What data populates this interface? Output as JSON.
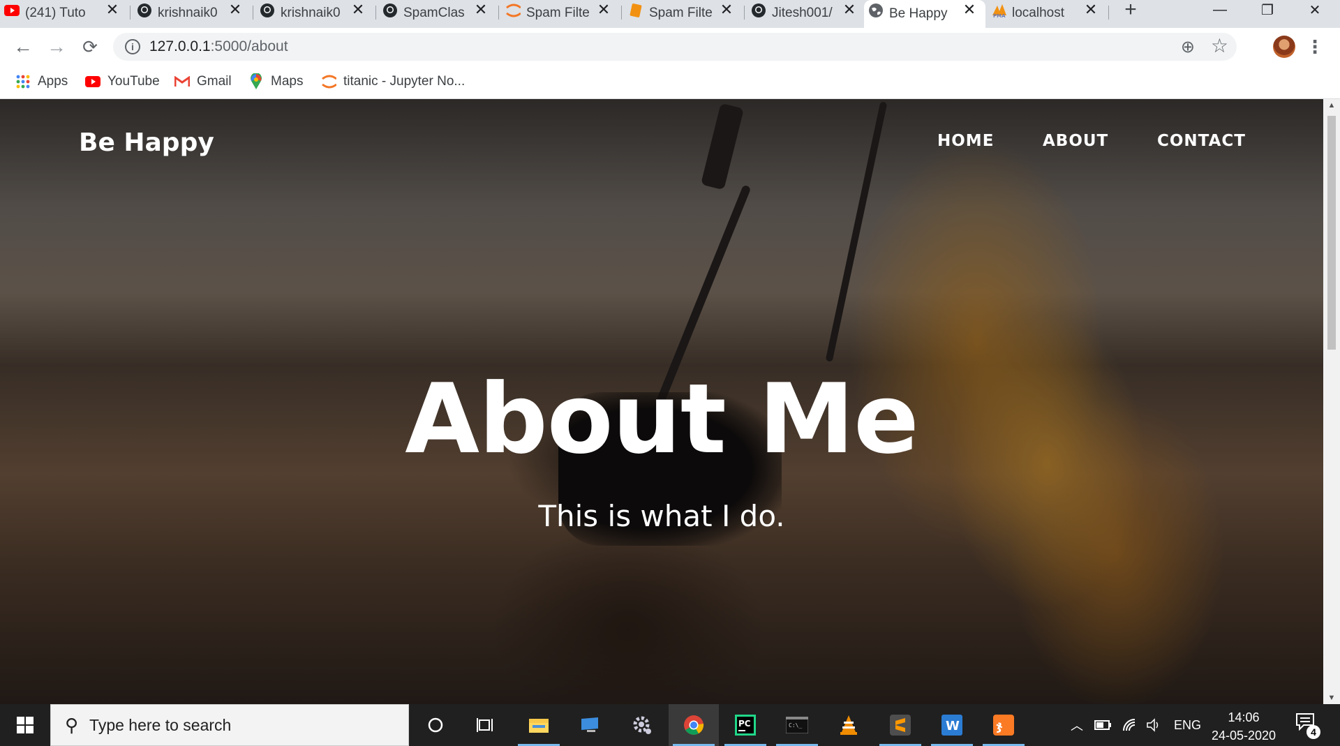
{
  "browser": {
    "tabs": [
      {
        "title": "(241) Tuto",
        "icon": "youtube-icon"
      },
      {
        "title": "krishnaik0",
        "icon": "github-icon"
      },
      {
        "title": "krishnaik0",
        "icon": "github-icon"
      },
      {
        "title": "SpamClas",
        "icon": "github-icon"
      },
      {
        "title": "Spam Filte",
        "icon": "jupyter-icon"
      },
      {
        "title": "Spam Filte",
        "icon": "notebook-icon"
      },
      {
        "title": "Jitesh001/",
        "icon": "github-icon"
      },
      {
        "title": "Be Happy",
        "icon": "globe-icon"
      },
      {
        "title": "localhost",
        "icon": "phpmyadmin-icon"
      }
    ],
    "new_tab_label": "+",
    "url_host": "127.0.0.1",
    "url_path": ":5000/about",
    "bookmarks": [
      {
        "label": "Apps",
        "icon": "apps-grid-icon"
      },
      {
        "label": "YouTube",
        "icon": "youtube-icon"
      },
      {
        "label": "Gmail",
        "icon": "gmail-icon"
      },
      {
        "label": "Maps",
        "icon": "maps-pin-icon"
      },
      {
        "label": "titanic - Jupyter No...",
        "icon": "jupyter-icon"
      }
    ]
  },
  "site": {
    "brand": "Be Happy",
    "nav": {
      "home": "HOME",
      "about": "ABOUT",
      "contact": "CONTACT"
    },
    "heading": "About Me",
    "subheading": "This is what I do."
  },
  "taskbar": {
    "search_placeholder": "Type here to search",
    "language": "ENG",
    "time": "14:06",
    "date": "24-05-2020",
    "notification_count": "4"
  },
  "colors": {
    "tab_strip": "#dee1e6",
    "taskbar": "#202020",
    "youtube_red": "#ff0000",
    "jupyter_orange": "#f37726",
    "active_indicator": "#76b9ed"
  }
}
